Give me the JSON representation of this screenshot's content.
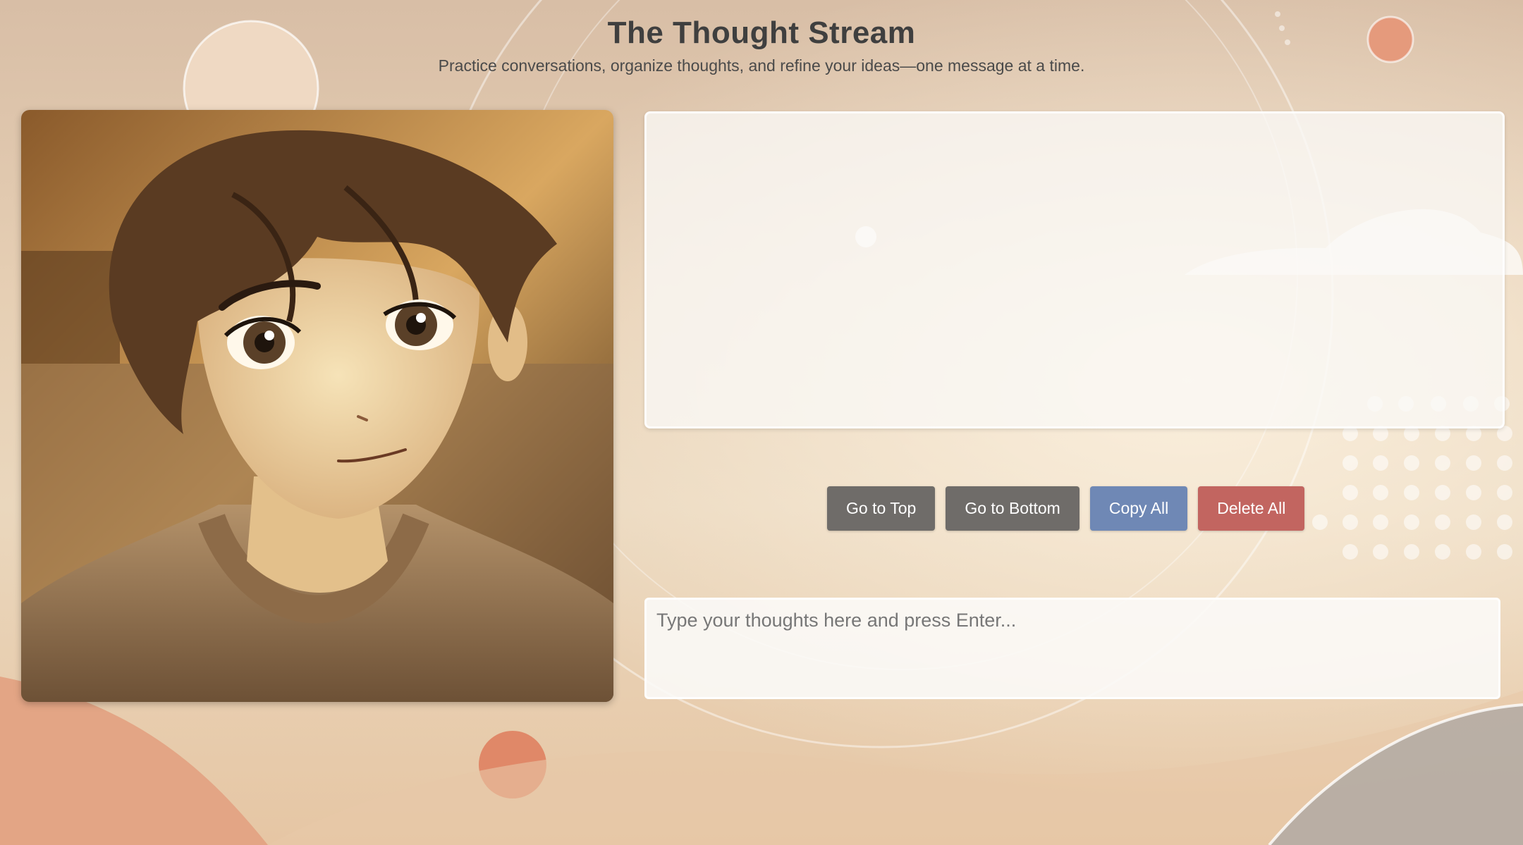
{
  "header": {
    "title": "The Thought Stream",
    "subtitle": "Practice conversations, organize thoughts, and refine your ideas—one message at a time."
  },
  "portrait": {
    "description_icon": "anime-boy-portrait"
  },
  "chat_log": {
    "messages": []
  },
  "controls": {
    "go_top_label": "Go to Top",
    "go_bottom_label": "Go to Bottom",
    "copy_all_label": "Copy All",
    "delete_all_label": "Delete All"
  },
  "input": {
    "placeholder": "Type your thoughts here and press Enter...",
    "value": ""
  },
  "colors": {
    "button_gray": "#6f6c69",
    "button_blue": "#6f88b5",
    "button_red": "#c26560",
    "title_text": "#3f3f3f"
  }
}
